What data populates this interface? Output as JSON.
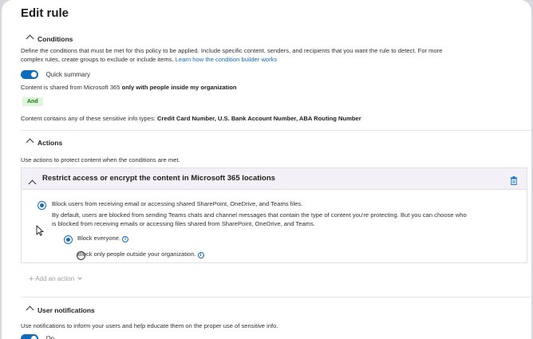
{
  "header": {
    "title": "Edit rule"
  },
  "conditions": {
    "heading": "Conditions",
    "description": "Define the conditions that must be met for this policy to be applied. Include specific content, senders, and recipients that you want the rule to detect. For more",
    "description_line2": "complex rules, create groups to exclude or include items.",
    "learn_link": "Learn how the condition builder works",
    "quick_summary_label": "Quick summary",
    "shared_prefix": "Content is shared from Microsoft 365",
    "shared_bold": "only with people inside my organization",
    "and_badge": "And",
    "contains_prefix": "Content contains any of these sensitive info types:",
    "contains_bold": "Credit Card Number, U.S. Bank Account Number, ABA Routing Number"
  },
  "actions": {
    "heading": "Actions",
    "description": "Use actions to protect content when the conditions are met.",
    "panel_title": "Restrict access or encrypt the content in Microsoft 365 locations",
    "block_option": "Block users from receiving email or accessing shared SharePoint, OneDrive, and Teams files.",
    "block_note_line1": "By default, users are blocked from sending Teams chats and channel messages that contain the type of content you're protecting. But you can choose who",
    "block_note_line2": "is blocked from receiving emails or accessing files shared from SharePoint, OneDrive, and Teams.",
    "block_everyone": "Block everyone.",
    "block_outside": "Block only people outside your organization.",
    "add_action": "Add an action"
  },
  "user_notifications": {
    "heading": "User notifications",
    "description": "Use notifications to inform your users and help educate them on the proper use of sensitive info.",
    "toggle_label": "On"
  },
  "colors": {
    "accent": "#0f6cbd",
    "panel_bg": "#f3f1f7",
    "and_badge_bg": "#dff6dd"
  },
  "icons": [
    "chevron-up-icon",
    "trash-icon",
    "info-icon",
    "plus-icon",
    "chevron-down-icon",
    "mouse-cursor-icon"
  ]
}
